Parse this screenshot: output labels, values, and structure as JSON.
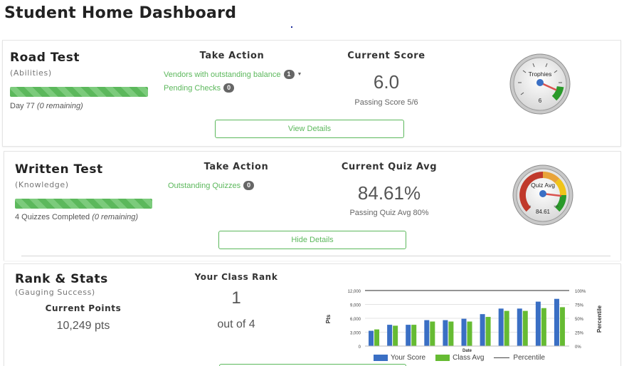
{
  "page": {
    "title": "Student Home Dashboard"
  },
  "road_test": {
    "title": "Road Test",
    "subtitle": "(Abilities)",
    "progress_percent": 100,
    "progress_text": "Day 77 ",
    "progress_remaining": "(0 remaining)",
    "action_heading": "Take Action",
    "actions": [
      {
        "label": "Vendors with outstanding balance",
        "count": "1"
      },
      {
        "label": "Pending Checks",
        "count": "0"
      }
    ],
    "score_heading": "Current Score",
    "score": "6.0",
    "passing": "Passing Score 5/6",
    "button": "View Details",
    "gauge": {
      "label": "Trophies",
      "value": "6",
      "min": 0,
      "max": 6,
      "reading": 6
    }
  },
  "written_test": {
    "title": "Written Test",
    "subtitle": "(Knowledge)",
    "progress_percent": 100,
    "progress_text": "4 Quizzes Completed ",
    "progress_remaining": "(0 remaining)",
    "action_heading": "Take Action",
    "actions": [
      {
        "label": "Outstanding Quizzes",
        "count": "0"
      }
    ],
    "score_heading": "Current Quiz Avg",
    "score": "84.61%",
    "passing": "Passing Quiz Avg 80%",
    "button": "Hide Details",
    "gauge": {
      "label": "Quiz Avg",
      "value": "84.61",
      "min": 0,
      "max": 100,
      "reading": 84.61,
      "tick_min": "0",
      "tick_max": "100"
    }
  },
  "rank_stats": {
    "title": "Rank & Stats",
    "subtitle": "(Gauging Success)",
    "points_heading": "Current Points",
    "points": "10,249 pts",
    "rank_heading": "Your Class Rank",
    "rank": "1",
    "rank_of": "out of 4"
  },
  "colors": {
    "green": "#5cb85c",
    "blue": "#3a6fc4",
    "chart_green": "#66bb33",
    "red": "#d9534f"
  },
  "chart_data": {
    "type": "bar",
    "xlabel": "Date",
    "ylabel": "Pts",
    "y2label": "Percentile",
    "ylim": [
      0,
      12000
    ],
    "yticks": [
      "0",
      "3,000",
      "6,000",
      "9,000",
      "12,000"
    ],
    "y2ticks": [
      "0%",
      "25%",
      "50%",
      "75%",
      "100%"
    ],
    "series": [
      {
        "name": "Your Score",
        "values": [
          3300,
          4600,
          4600,
          5600,
          5600,
          5900,
          6900,
          8100,
          8100,
          9600,
          10200
        ]
      },
      {
        "name": "Class Avg",
        "values": [
          3600,
          4400,
          4600,
          5300,
          5300,
          5300,
          6300,
          7600,
          7600,
          8200,
          8400
        ]
      }
    ],
    "line": {
      "name": "Percentile",
      "values": [
        100,
        100,
        100,
        100,
        100,
        100,
        100,
        100,
        100,
        100,
        100
      ]
    },
    "grid": true,
    "legend": "bottom"
  }
}
